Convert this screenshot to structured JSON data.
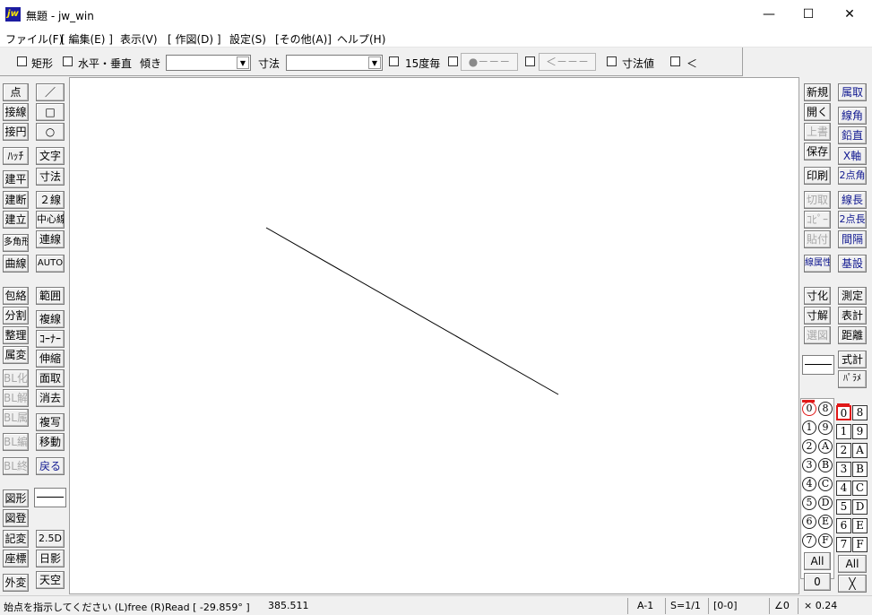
{
  "window": {
    "app_icon": "jw",
    "title": "無題 - jw_win",
    "minimize": "—",
    "maximize": "☐",
    "close": "✕"
  },
  "menu": [
    "ファイル(F)",
    "[ 編集(E) ]",
    "表示(V)",
    "[ 作図(D) ]",
    "設定(S)",
    "[その他(A)]",
    "ヘルプ(H)"
  ],
  "toolbar": {
    "rect": "矩形",
    "hv": "水平・垂直",
    "tilt": "傾き",
    "tilt_value": "",
    "dim": "寸法",
    "dim_value": "",
    "deg15": "15度毎",
    "dot_btn": "●－－－",
    "arrow_btn": "＜－－－",
    "dimval": "寸法値",
    "lt": "＜"
  },
  "left_tools": [
    [
      "点",
      "／"
    ],
    [
      "接線",
      "□"
    ],
    [
      "接円",
      "○"
    ],
    [
      "ﾊｯﾁ",
      "文字"
    ],
    [
      "建平",
      "寸法"
    ],
    [
      "建断",
      "２線"
    ],
    [
      "建立",
      "中心線"
    ],
    [
      "多角形",
      "連線"
    ],
    [
      "曲線",
      "AUTO"
    ],
    [
      "包絡",
      "範囲"
    ],
    [
      "分割",
      "複線"
    ],
    [
      "整理",
      "ｺｰﾅｰ"
    ],
    [
      "属変",
      "伸縮"
    ],
    [
      "BL化",
      "面取"
    ],
    [
      "BL解",
      "消去"
    ],
    [
      "BL属",
      "複写"
    ],
    [
      "BL編",
      "移動"
    ],
    [
      "BL終",
      "戻る"
    ],
    [
      "図形",
      ""
    ],
    [
      "図登",
      ""
    ],
    [
      "記変",
      "2.5D"
    ],
    [
      "座標",
      "日影"
    ],
    [
      "外変",
      "天空"
    ]
  ],
  "right_tools": [
    [
      "新規",
      "属取"
    ],
    [
      "開く",
      "線角"
    ],
    [
      "上書",
      "鉛直"
    ],
    [
      "保存",
      "X軸"
    ],
    [
      "印刷",
      "2点角"
    ],
    [
      "切取",
      "線長"
    ],
    [
      "ｺﾋﾟｰ",
      "2点長"
    ],
    [
      "貼付",
      "間隔"
    ],
    [
      "線属性",
      "基設"
    ],
    [
      "寸化",
      "測定"
    ],
    [
      "寸解",
      "表計"
    ],
    [
      "選図",
      "距離"
    ],
    [
      "",
      "式計"
    ],
    [
      "",
      "ﾊﾟﾗﾒ"
    ]
  ],
  "layer_groups": [
    "0",
    "1",
    "2",
    "3",
    "4",
    "5",
    "6",
    "7",
    "8",
    "9",
    "A",
    "B",
    "C",
    "D",
    "E",
    "F"
  ],
  "layers": [
    "0",
    "1",
    "2",
    "3",
    "4",
    "5",
    "6",
    "7",
    "8",
    "9",
    "A",
    "B",
    "C",
    "D",
    "E",
    "F"
  ],
  "layer_all": "All",
  "layer_group_all": "All",
  "layer_bottom_left": "0",
  "layer_bottom_right": "╳",
  "status": {
    "message": "始点を指示してください (L)free (R)Read [ -29.859° ]",
    "length": "385.511",
    "paper": "A-1",
    "scale": "S=1/1",
    "layer": "[0-0]",
    "angle": "∠0",
    "zoom": "× 0.24"
  },
  "colors": {
    "title_icon_bg": "#1c1ca0",
    "active_layer": "#e01818",
    "blue_text": "#101890",
    "canvas_bg": "#ffffff"
  },
  "drawing": {
    "line_count": 1
  }
}
